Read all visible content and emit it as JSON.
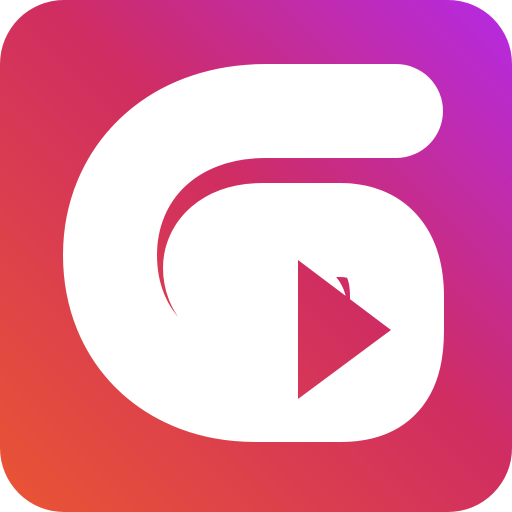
{
  "icon": {
    "name": "app-logo-g-arrow",
    "colors": {
      "gradient_start": "#ea5533",
      "gradient_mid": "#cf2d62",
      "gradient_end": "#b42ae6",
      "glyph": "#ffffff"
    }
  }
}
